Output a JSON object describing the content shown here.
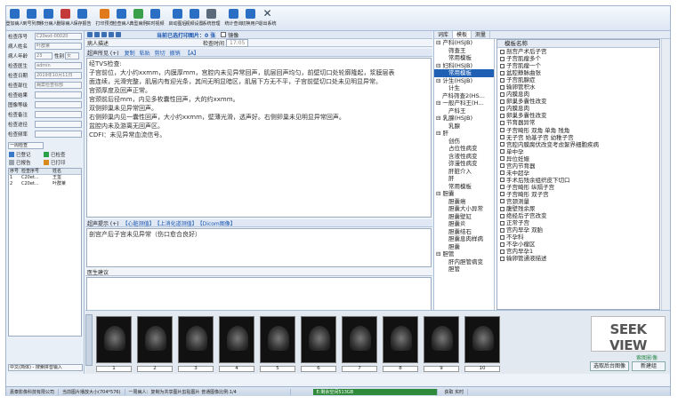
{
  "toolbar": {
    "buttons": [
      "登加病人",
      "到号列表",
      "移分病人",
      "删除病人",
      "保存报告",
      "打印预览",
      "检查病人",
      "典型病例",
      "实时视频",
      "启动图后",
      "视频设置",
      "系统管理",
      "统计查询",
      "切换用户",
      "退出系统"
    ],
    "status_message": "当前已选打印图片：0 张",
    "mirror_label": "镜像"
  },
  "left_form": {
    "fields": [
      {
        "label": "检查序号",
        "value": "C20ext-00020"
      },
      {
        "label": "病人姓名",
        "value": "叶群莱"
      },
      {
        "label": "病人年龄",
        "value": "23",
        "extra_label": "性别",
        "extra_value": "女"
      },
      {
        "label": "检查医生",
        "value": "admin"
      },
      {
        "label": "检查日期",
        "value": "2019年10月11日"
      },
      {
        "label": "检查部位",
        "value": "病案检查标部"
      },
      {
        "label": "检查结果",
        "value": ""
      },
      {
        "label": "图像等级",
        "value": ""
      },
      {
        "label": "检查备注",
        "value": ""
      },
      {
        "label": "检查途径",
        "value": ""
      },
      {
        "label": "检查频率",
        "value": ""
      }
    ],
    "filter_select": "一周检查",
    "legend": [
      {
        "label": "已登记",
        "color": "#3a78c8"
      },
      {
        "label": "已检查",
        "color": "#2aa04a"
      },
      {
        "label": "已报告",
        "color": "#9aa3ad"
      },
      {
        "label": "已打印",
        "color": "#d98a1f"
      }
    ],
    "list_headers": [
      "序号",
      "检查序号",
      "姓名"
    ],
    "list_rows": [
      [
        "1",
        "C20et...",
        "王玺"
      ],
      [
        "2",
        "C20et...",
        "叶群莱"
      ]
    ],
    "language_select": "中文(简体) - 搜索拼音输入"
  },
  "center": {
    "top_bar_label": "病人描述",
    "check_date_label": "检查时间",
    "check_date_value": "17:05",
    "findings_label": "超声所见 (+)",
    "findings_actions": [
      "复制",
      "粘贴",
      "剪切",
      "撤销"
    ],
    "findings_extra": "【A】",
    "findings_lines": [
      "经TVS检查:",
      "子宫前位，大小约xxmm，内膜厚mm，宫腔内未见异常回声，肌层回声均匀，前壁切口处轮廓隆起，浆膜层表",
      "面连续，光滑完整，肌层内有迎光条，其间无明显暗区，肌层下方无不平，子宫前壁切口处未见明显异常。",
      "宫颈厚度及回声正常。",
      "宫颈前后径mm，内见多枚囊性回声，大的约xxmm。",
      "双侧卵巢未见异常回声。",
      "右侧卵巢内见一囊性回声，大小约xxmm，壁薄光滑，透声好。右侧卵巢未见明显异常回声。",
      "盆腔内未及游离无回声区。",
      "CDFI：未见异常血流信号。"
    ],
    "conclusion_label": "超声提示 (+)",
    "conclusion_links": [
      "【心脏测值】",
      "【上消化道测值】",
      "【Dicom图像】"
    ],
    "conclusion_text": "剖宫产后子宫未见异常（伤口愈合良好）",
    "advice_label": "医生建议"
  },
  "right_panel": {
    "tabs": [
      "词库",
      "模板",
      "测量"
    ],
    "tree": [
      {
        "text": "⊟ 产科(HSJB)",
        "level": 0
      },
      {
        "text": "筛查王",
        "level": 2
      },
      {
        "text": "常用模板",
        "level": 2
      },
      {
        "text": "⊟ 妇科(HSJB)",
        "level": 0
      },
      {
        "text": "常用模板",
        "level": 2,
        "selected": true
      },
      {
        "text": "⊟ 计生(HSJB)",
        "level": 0
      },
      {
        "text": "计生",
        "level": 2
      },
      {
        "text": "产科筛查2(HS...",
        "level": 1
      },
      {
        "text": "⊟ 一般产科王(H...",
        "level": 0
      },
      {
        "text": "产科王",
        "level": 2
      },
      {
        "text": "⊟ 乳腺(HSJB)",
        "level": 0
      },
      {
        "text": "乳腺",
        "level": 2
      },
      {
        "text": "⊟ 肝",
        "level": 0
      },
      {
        "text": "创伤",
        "level": 2
      },
      {
        "text": "占位性病变",
        "level": 2
      },
      {
        "text": "含液性病变",
        "level": 2
      },
      {
        "text": "弥漫性病变",
        "level": 2
      },
      {
        "text": "肝脏介入",
        "level": 2
      },
      {
        "text": "肝",
        "level": 2
      },
      {
        "text": "常用模板",
        "level": 2
      },
      {
        "text": "⊟ 胆囊",
        "level": 0
      },
      {
        "text": "胆囊癌",
        "level": 2
      },
      {
        "text": "胆囊大小异常",
        "level": 2
      },
      {
        "text": "胆囊壁缸",
        "level": 2
      },
      {
        "text": "胆囊炎",
        "level": 2
      },
      {
        "text": "胆囊结石",
        "level": 2
      },
      {
        "text": "胆囊息肉样病",
        "level": 2
      },
      {
        "text": "胆囊",
        "level": 2
      },
      {
        "text": "⊟ 胆管",
        "level": 0
      },
      {
        "text": "肝内胆管病变",
        "level": 2
      },
      {
        "text": "胆管",
        "level": 2
      }
    ],
    "template_header": "模板名称",
    "templates": [
      "剖宫产术后子宫",
      "子宫肌瘤多个",
      "子宫肌瘤一个",
      "盆腔静脉曲张",
      "子宫肌腺症",
      "输卵管积水",
      "内膜息肉",
      "卵巢多囊性改变",
      "内膜息肉",
      "卵巢多囊性改变",
      "节育器异常",
      "子宫畸形 双角 单角 残角",
      "无子宫 始基子宫 幼稚子宫",
      "宫腔内膜腐伏改变考虑絮界细胞疾病",
      "单中孕",
      "异位妊娠",
      "宫内节育器",
      "未中超孕",
      "手术后残余组织皮下切口",
      "子宫畸形 纵隔子宫",
      "子宫畸形 双子宫",
      "宫颈测量",
      "腹壁残余尿",
      "绝经后子宫改变",
      "正常子宫",
      "宫内早孕 双胎",
      "不孕科",
      "不孕小瘤区",
      "宫内早孕1",
      "输卵管通液描述"
    ]
  },
  "thumbnails": {
    "numbers": [
      "1",
      "2",
      "3",
      "4",
      "5",
      "6",
      "7",
      "8",
      "9",
      "10"
    ]
  },
  "logo": {
    "text": "SEEK VIEW",
    "sub": "索图影像"
  },
  "bottom_buttons": [
    "选取后台图像",
    "新建组"
  ],
  "status_bar": {
    "items": [
      "嘉泰影像科技有限公司",
      "当前图片播放大小(704*576)",
      "一周病人：复制为共享图片剪贴图片 普通图像比例:1/4"
    ],
    "disk": "E:剩余空间513GB",
    "service": "获取 实时"
  }
}
